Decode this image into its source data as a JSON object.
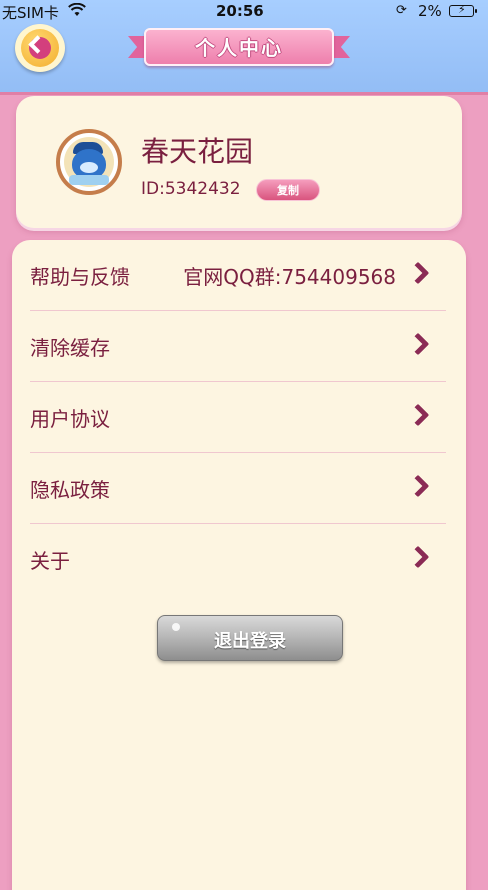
{
  "status_bar": {
    "carrier": "无SIM卡",
    "time": "20:56",
    "battery": "2%"
  },
  "header": {
    "back_icon": "chevron-left-icon",
    "title": "个人中心"
  },
  "profile": {
    "username": "春天花园",
    "id_text": "ID:5342432",
    "copy_label": "复制"
  },
  "menu": {
    "items": [
      {
        "label": "帮助与反馈",
        "extra": "官网QQ群:754409568"
      },
      {
        "label": "清除缓存",
        "extra": ""
      },
      {
        "label": "用户协议",
        "extra": ""
      },
      {
        "label": "隐私政策",
        "extra": ""
      },
      {
        "label": "关于",
        "extra": ""
      }
    ]
  },
  "logout_label": "退出登录",
  "colors": {
    "background": "#ed9fc1",
    "header": "#a7ceff",
    "card": "#fdf5e1",
    "text": "#7a1f3f",
    "accent": "#e1649c"
  }
}
